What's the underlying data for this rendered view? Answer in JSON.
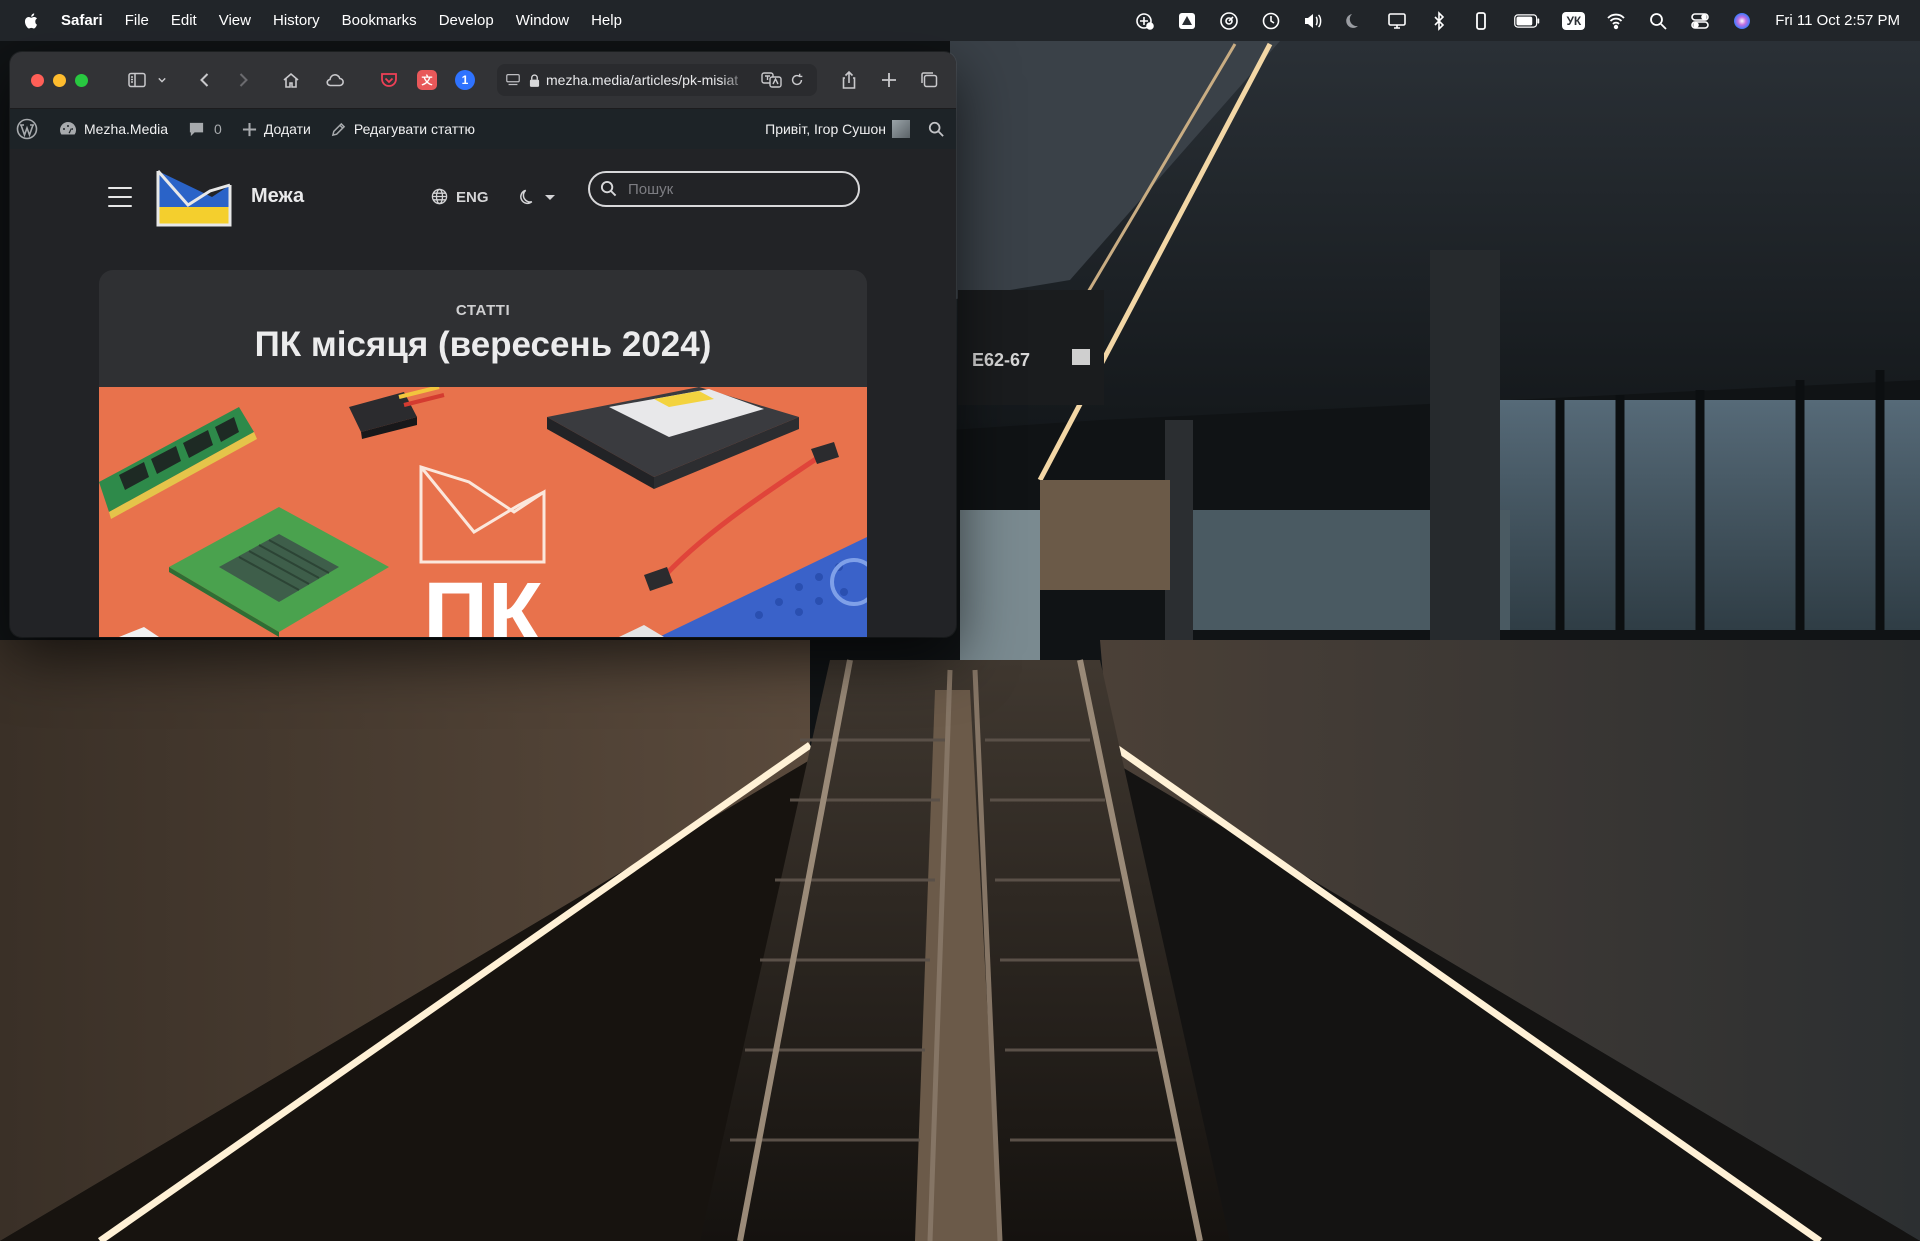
{
  "menubar": {
    "app_name": "Safari",
    "menus": [
      "File",
      "Edit",
      "View",
      "History",
      "Bookmarks",
      "Develop",
      "Window",
      "Help"
    ],
    "keyboard_layout": "УК",
    "clock": "Fri 11 Oct  2:57 PM",
    "status_icons": [
      "vpn-icon",
      "drive-icon",
      "speed-icon",
      "time-machine-icon",
      "volume-icon",
      "moon-icon",
      "display-icon",
      "bluetooth-icon",
      "phone-icon",
      "battery-icon",
      "keyboard-layout",
      "wifi-icon",
      "spotlight-icon",
      "control-center-icon",
      "siri-icon"
    ]
  },
  "browser": {
    "url": "mezha.media/articles/pk-misiat",
    "toolbar_icons": [
      "sidebar-icon",
      "chevron-down-icon",
      "back-icon",
      "forward-icon",
      "home-icon",
      "icloud-icon",
      "pocket-icon",
      "extension-icon",
      "onepassword-icon",
      "translate-icon",
      "reload-icon",
      "share-icon",
      "plus-icon",
      "tabs-icon"
    ]
  },
  "wp_admin": {
    "site_name": "Mezha.Media",
    "comments_count": "0",
    "add_label": "Додати",
    "edit_label": "Редагувати статтю",
    "greeting": "Привіт, Ігор Сушон"
  },
  "site": {
    "title": "Межа",
    "lang_label": "ENG",
    "search_placeholder": "Пошук"
  },
  "article": {
    "category": "СТАТТІ",
    "title": "ПК місяця (вересень 2024)",
    "hero_text": "ПК"
  },
  "colors": {
    "hero_background": "#e8724c",
    "accent_blue": "#2f73ff",
    "wp_bar": "#1d2327"
  }
}
